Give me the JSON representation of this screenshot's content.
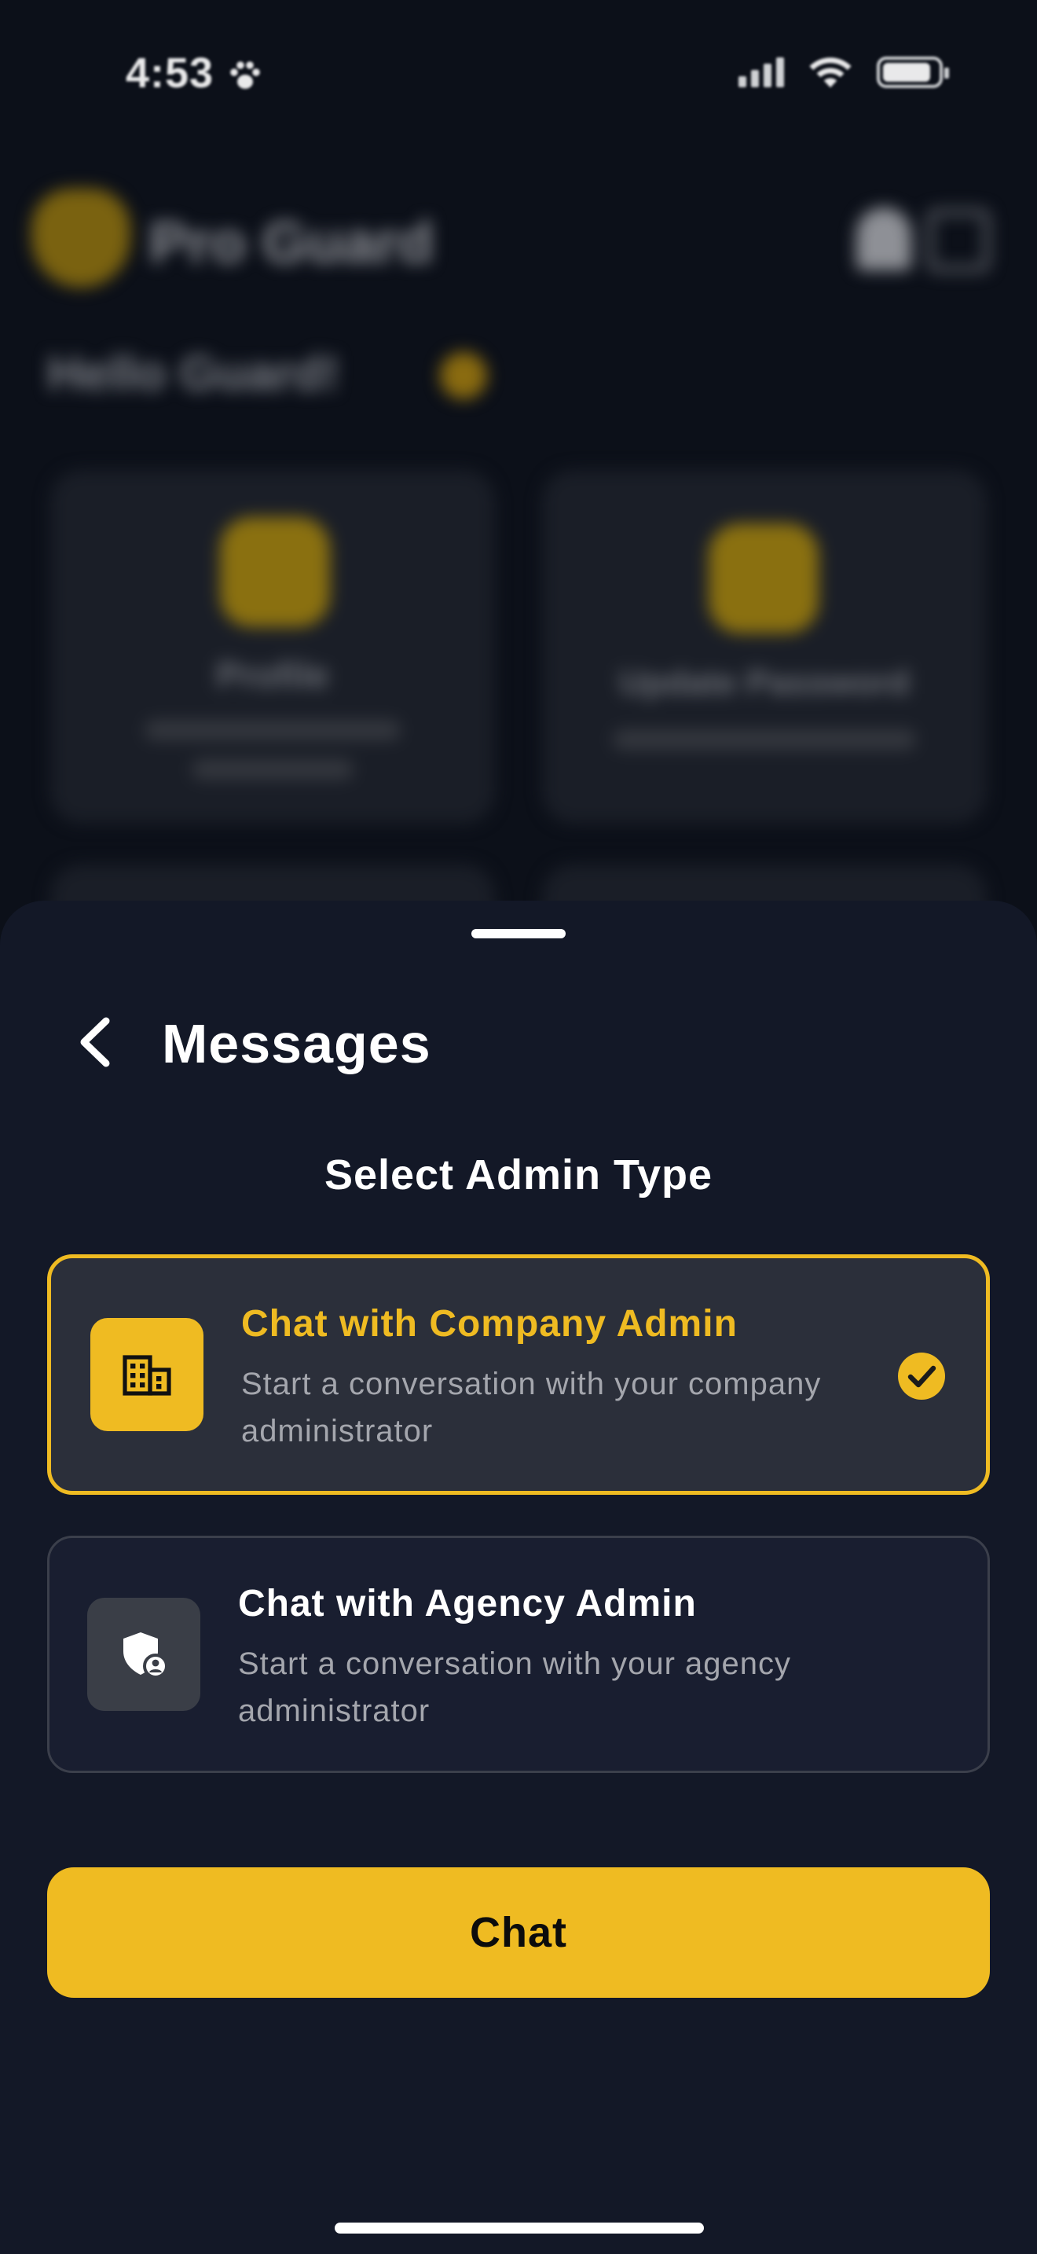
{
  "status_bar": {
    "time": "4:53",
    "icons": [
      "paw-icon",
      "signal-icon",
      "wifi-icon",
      "battery-icon"
    ]
  },
  "background_app": {
    "brand": "Pro Guard",
    "greeting": "Hello Guard!",
    "cards": [
      {
        "title": "Profile"
      },
      {
        "title": "Update Password"
      }
    ]
  },
  "sheet": {
    "title": "Messages",
    "section_title": "Select Admin Type",
    "options": [
      {
        "title": "Chat with Company Admin",
        "description": "Start a conversation with your company administrator",
        "icon": "building-icon",
        "selected": true
      },
      {
        "title": "Chat with Agency Admin",
        "description": "Start a conversation with your agency administrator",
        "icon": "shield-user-icon",
        "selected": false
      }
    ],
    "action_label": "Chat"
  },
  "colors": {
    "accent": "#efbb22",
    "sheet_background": "#131827",
    "selected_card": "#2b2f3a",
    "unselected_card": "#191e30"
  }
}
